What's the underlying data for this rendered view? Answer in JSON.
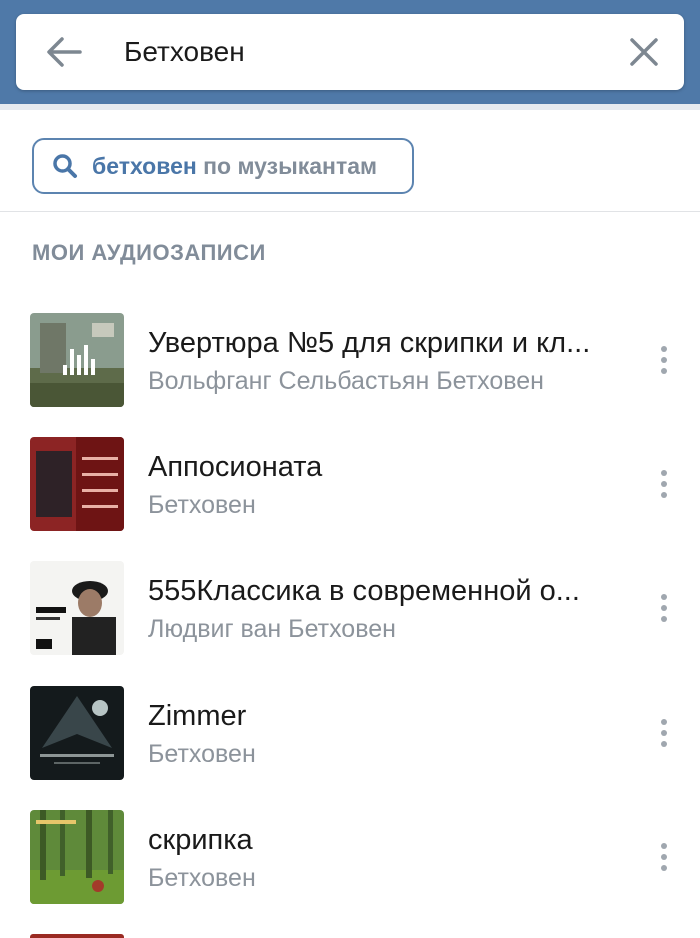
{
  "search": {
    "query": "Бетховен",
    "back_icon": "arrow-left-icon",
    "clear_icon": "close-icon"
  },
  "suggestion": {
    "icon": "search-icon",
    "query": "бетховен",
    "suffix": " по музыкантам"
  },
  "section": {
    "title": "МОИ АУДИОЗАПИСИ"
  },
  "tracks": [
    {
      "title": "Увертюра №5 для скрипки и кл...",
      "artist": "Вольфганг Сельбастьян Бетховен",
      "now_playing": true
    },
    {
      "title": "Аппосионата",
      "artist": "Бетховен"
    },
    {
      "title": "555Классика в современной о...",
      "artist": "Людвиг ван Бетховен"
    },
    {
      "title": "Zimmer",
      "artist": "Бетховен"
    },
    {
      "title": "скрипка",
      "artist": "Бетховен"
    }
  ],
  "colors": {
    "header": "#4f79a8",
    "accent": "#4a76a8",
    "secondary_text": "#818c99"
  }
}
